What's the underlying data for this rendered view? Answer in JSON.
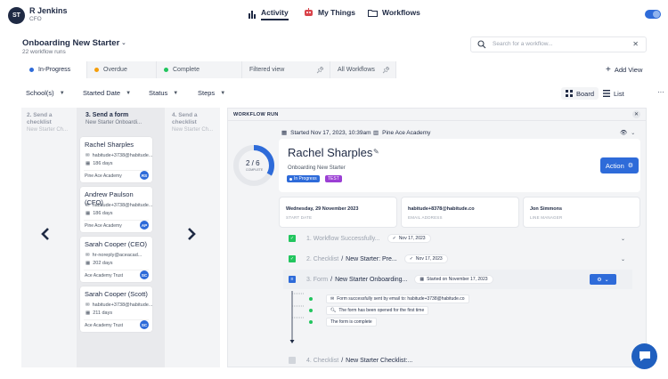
{
  "user": {
    "initials": "ST",
    "name": "R Jenkins",
    "role": "CFO"
  },
  "nav": {
    "activity": "Activity",
    "my_things": "My Things",
    "workflows": "Workflows"
  },
  "page": {
    "title": "Onboarding New Starter",
    "count": "22 workflow runs"
  },
  "search": {
    "placeholder": "Search for a workflow..."
  },
  "tabs": [
    {
      "label": "In-Progress",
      "color": "#2e6bd9"
    },
    {
      "label": "Overdue",
      "color": "#f59e0b"
    },
    {
      "label": "Complete",
      "color": "#22c55e"
    },
    {
      "label": "Filtered view"
    },
    {
      "label": "All Workflows"
    }
  ],
  "add_view": "Add View",
  "filters": {
    "schools": "School(s)",
    "started_date": "Started Date",
    "status": "Status",
    "steps": "Steps"
  },
  "views": {
    "board": "Board",
    "list": "List"
  },
  "board": {
    "col_prev": {
      "head": "2. Send a checklist",
      "sub": "New Starter Ch..."
    },
    "col_cur": {
      "head": "3. Send a form",
      "sub": "New Starter Onboardi..."
    },
    "col_next": {
      "head": "4. Send a checklist",
      "sub": "New Starter Ch..."
    },
    "cards": [
      {
        "name": "Rachel Sharples",
        "email": "habitude+3738@habitude...",
        "days": "186 days",
        "school": "Pine Ace Academy",
        "initials": "RS"
      },
      {
        "name": "Andrew Paulson (CFO)",
        "email": "habitude+3738@habitude...",
        "days": "186 days",
        "school": "Pine Ace Academy",
        "initials": "AP"
      },
      {
        "name": "Sarah Cooper (CEO)",
        "email": "hr-noreply@aceacad...",
        "days": "202 days",
        "school": "Ace Academy Trust",
        "initials": "SC"
      },
      {
        "name": "Sarah Cooper (Scott)",
        "email": "habitude+3738@habitude...",
        "days": "211 days",
        "school": "Ace Academy Trust",
        "initials": "SC"
      }
    ]
  },
  "panel": {
    "label": "WORKFLOW RUN",
    "started": "Started Nov 17, 2023, 10:39am",
    "school": "Pine Ace Academy",
    "progress": {
      "done": 2,
      "total": 6,
      "text": "2 / 6",
      "label": "COMPLETE"
    },
    "person": "Rachel Sharples",
    "workflow": "Onboarding New Starter",
    "status": "In Progress",
    "tag": "TEST",
    "action": "Action",
    "info": [
      {
        "value": "Wednesday, 29 November 2023",
        "key": "START DATE"
      },
      {
        "value": "habitude+8378@habitude.co",
        "key": "EMAIL ADDRESS"
      },
      {
        "value": "Jon Simmons",
        "key": "LINE MANAGER"
      }
    ],
    "steps": [
      {
        "num": "1. Workflow Successfully...",
        "title": "",
        "date": "Nov 17, 2023"
      },
      {
        "num": "2. Checklist",
        "title": "New Starter: Pre...",
        "date": "Nov 17, 2023"
      },
      {
        "num": "3. Form",
        "title": "New Starter Onboarding...",
        "date": "Started on November 17, 2023"
      },
      {
        "num": "4. Checklist",
        "title": "New Starter Checklist:..."
      }
    ],
    "history": [
      "Form successfully sent by email to: habitude+3738@habitude.co",
      "The form has been opened for the first time",
      "The form is complete"
    ]
  }
}
